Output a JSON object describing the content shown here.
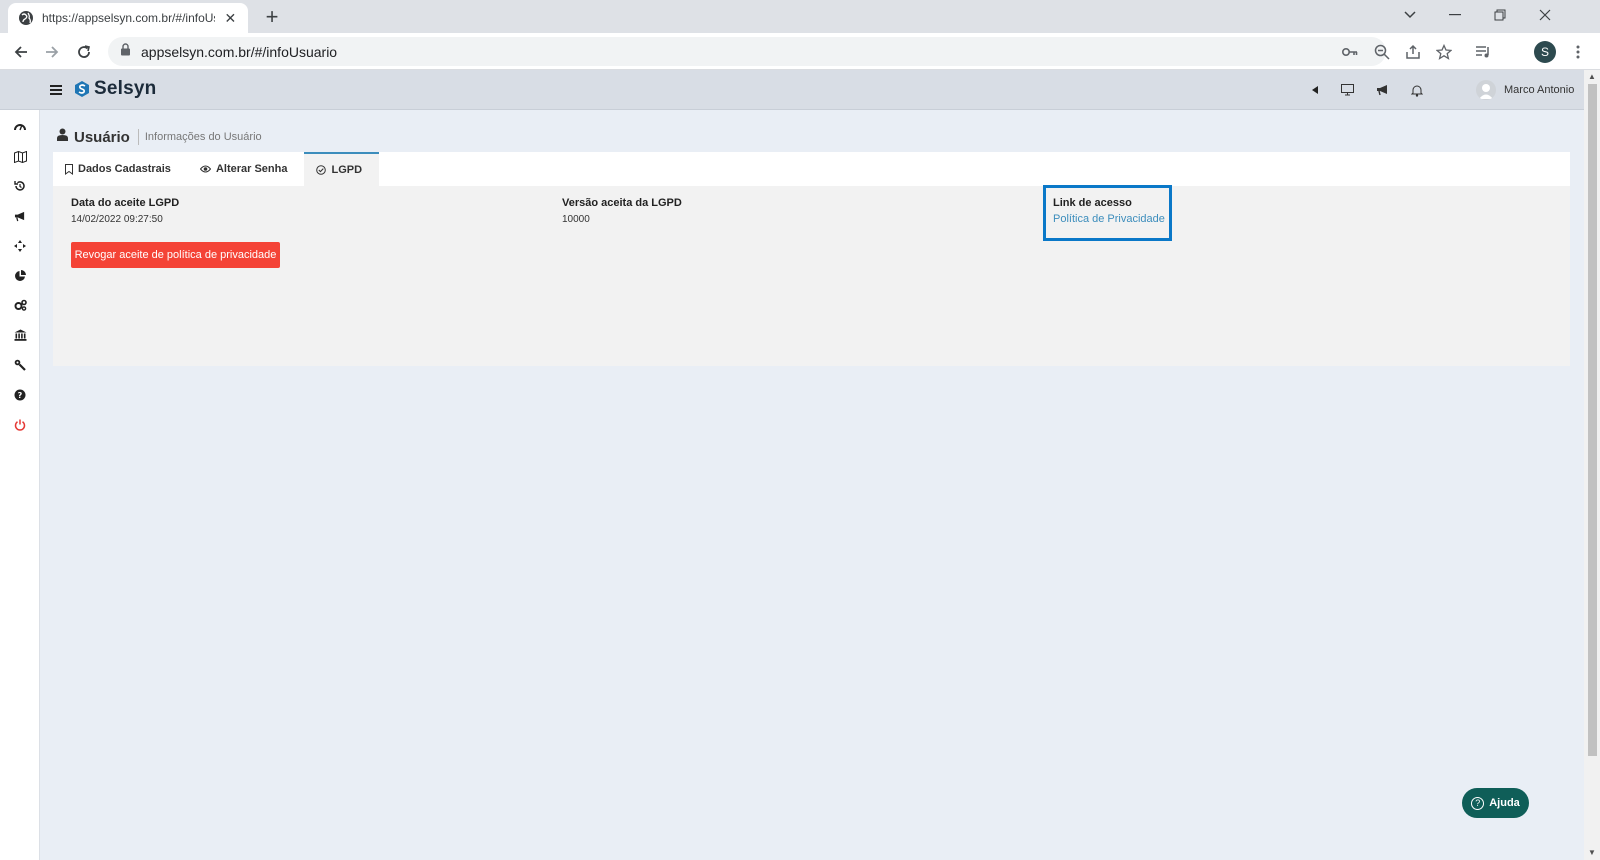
{
  "browser": {
    "tab_title": "https://appselsyn.com.br/#/infoUsuario",
    "url": "appselsyn.com.br/#/infoUsuario",
    "profile_initial": "S"
  },
  "header": {
    "logo_text": "Selsyn",
    "user_name": "Marco Antonio"
  },
  "page": {
    "title": "Usuário",
    "subtitle": "Informações do Usuário"
  },
  "tabs": [
    {
      "label": "Dados Cadastrais"
    },
    {
      "label": "Alterar Senha"
    },
    {
      "label": "LGPD"
    }
  ],
  "lgpd": {
    "date_label": "Data do aceite LGPD",
    "date_value": "14/02/2022 09:27:50",
    "version_label": "Versão aceita da LGPD",
    "version_value": "10000",
    "link_label": "Link de acesso",
    "link_text": "Política de Privacidade",
    "revoke_button": "Revogar aceite de política de privacidade"
  },
  "help_button": "Ajuda",
  "colors": {
    "accent": "#3c8dbc",
    "danger": "#f44336",
    "help": "#0f5e58",
    "highlight": "#0a78c8"
  }
}
